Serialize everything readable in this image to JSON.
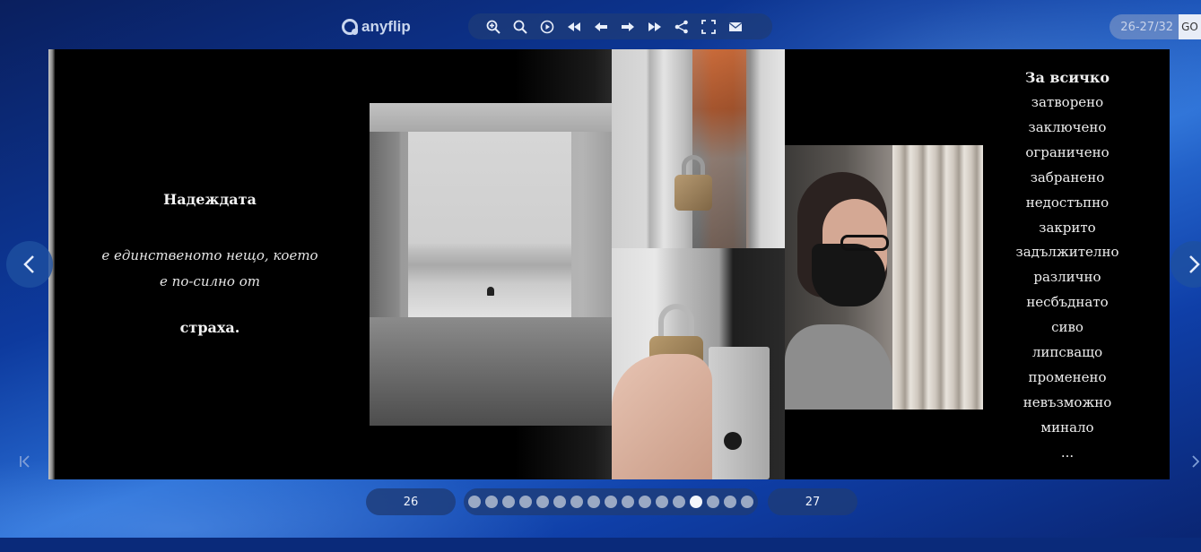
{
  "app": {
    "logo_text": "anyflip"
  },
  "toolbar": {
    "buttons": [
      {
        "icon": "zoom-in-icon"
      },
      {
        "icon": "search-icon"
      },
      {
        "icon": "autoplay-icon"
      },
      {
        "icon": "first-page-icon"
      },
      {
        "icon": "previous-page-icon"
      },
      {
        "icon": "next-page-icon"
      },
      {
        "icon": "last-page-icon"
      },
      {
        "icon": "share-icon"
      },
      {
        "icon": "fullscreen-icon"
      },
      {
        "icon": "email-icon"
      }
    ]
  },
  "page_nav": {
    "current_value": "26-27/32",
    "go_label": "GO"
  },
  "book": {
    "left_page": {
      "title": "Надеждата",
      "italic_line1": "е единственото нещо, което",
      "italic_line2": "е по-силно от",
      "ending": "страха."
    },
    "right_page": {
      "title": "За всичко",
      "lines": [
        "затворено",
        "заключено",
        "ограничено",
        "забранено",
        "недостъпно",
        "закрито",
        "задължително",
        "различно",
        "несбъднато",
        "сиво",
        "липсващо",
        "променено",
        "невъзможно",
        "минало",
        "..."
      ]
    }
  },
  "pager": {
    "left_page_number": "26",
    "right_page_number": "27",
    "dot_count": 17,
    "active_dot": 13
  }
}
